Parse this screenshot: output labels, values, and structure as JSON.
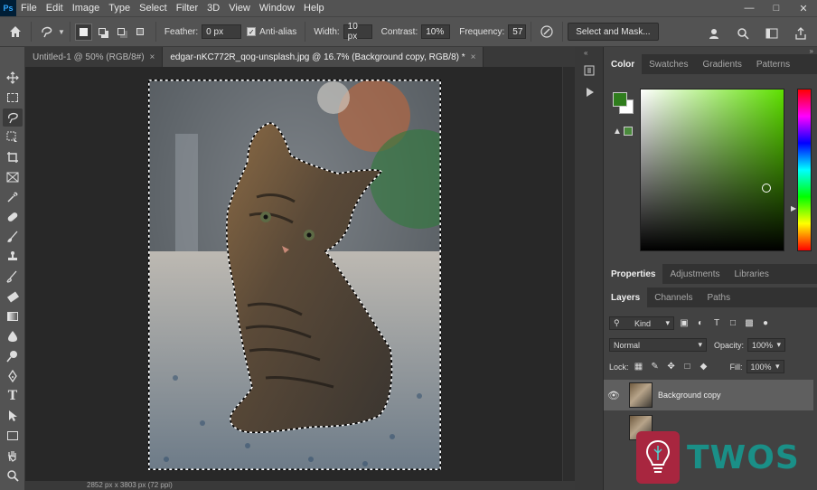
{
  "menu": {
    "items": [
      "File",
      "Edit",
      "Image",
      "Type",
      "Select",
      "Filter",
      "3D",
      "View",
      "Window",
      "Help"
    ],
    "logo": "Ps"
  },
  "options": {
    "feather_label": "Feather:",
    "feather_value": "0 px",
    "antialias_label": "Anti-alias",
    "width_label": "Width:",
    "width_value": "10 px",
    "contrast_label": "Contrast:",
    "contrast_value": "10%",
    "frequency_label": "Frequency:",
    "frequency_value": "57",
    "select_mask_label": "Select and Mask..."
  },
  "tabs": [
    {
      "label": "Untitled-1 @ 50% (RGB/8#)",
      "active": false
    },
    {
      "label": "edgar-nKC772R_qog-unsplash.jpg @ 16.7% (Background copy, RGB/8) *",
      "active": true
    }
  ],
  "status": {
    "text": "2852 px x 3803 px (72 ppi)"
  },
  "color_panel": {
    "tabs": [
      "Color",
      "Swatches",
      "Gradients",
      "Patterns"
    ],
    "foreground": "#2f7d1d",
    "background": "#ffffff"
  },
  "properties_panel": {
    "tabs": [
      "Properties",
      "Adjustments",
      "Libraries"
    ]
  },
  "layers_panel": {
    "tabs": [
      "Layers",
      "Channels",
      "Paths"
    ],
    "filter_kind": "Kind",
    "blend_mode": "Normal",
    "opacity_label": "Opacity:",
    "opacity_value": "100%",
    "lock_label": "Lock:",
    "fill_label": "Fill:",
    "fill_value": "100%",
    "layers": [
      {
        "name": "Background copy",
        "visible": true,
        "selected": true
      }
    ]
  },
  "watermark": {
    "text": "TWOS"
  }
}
